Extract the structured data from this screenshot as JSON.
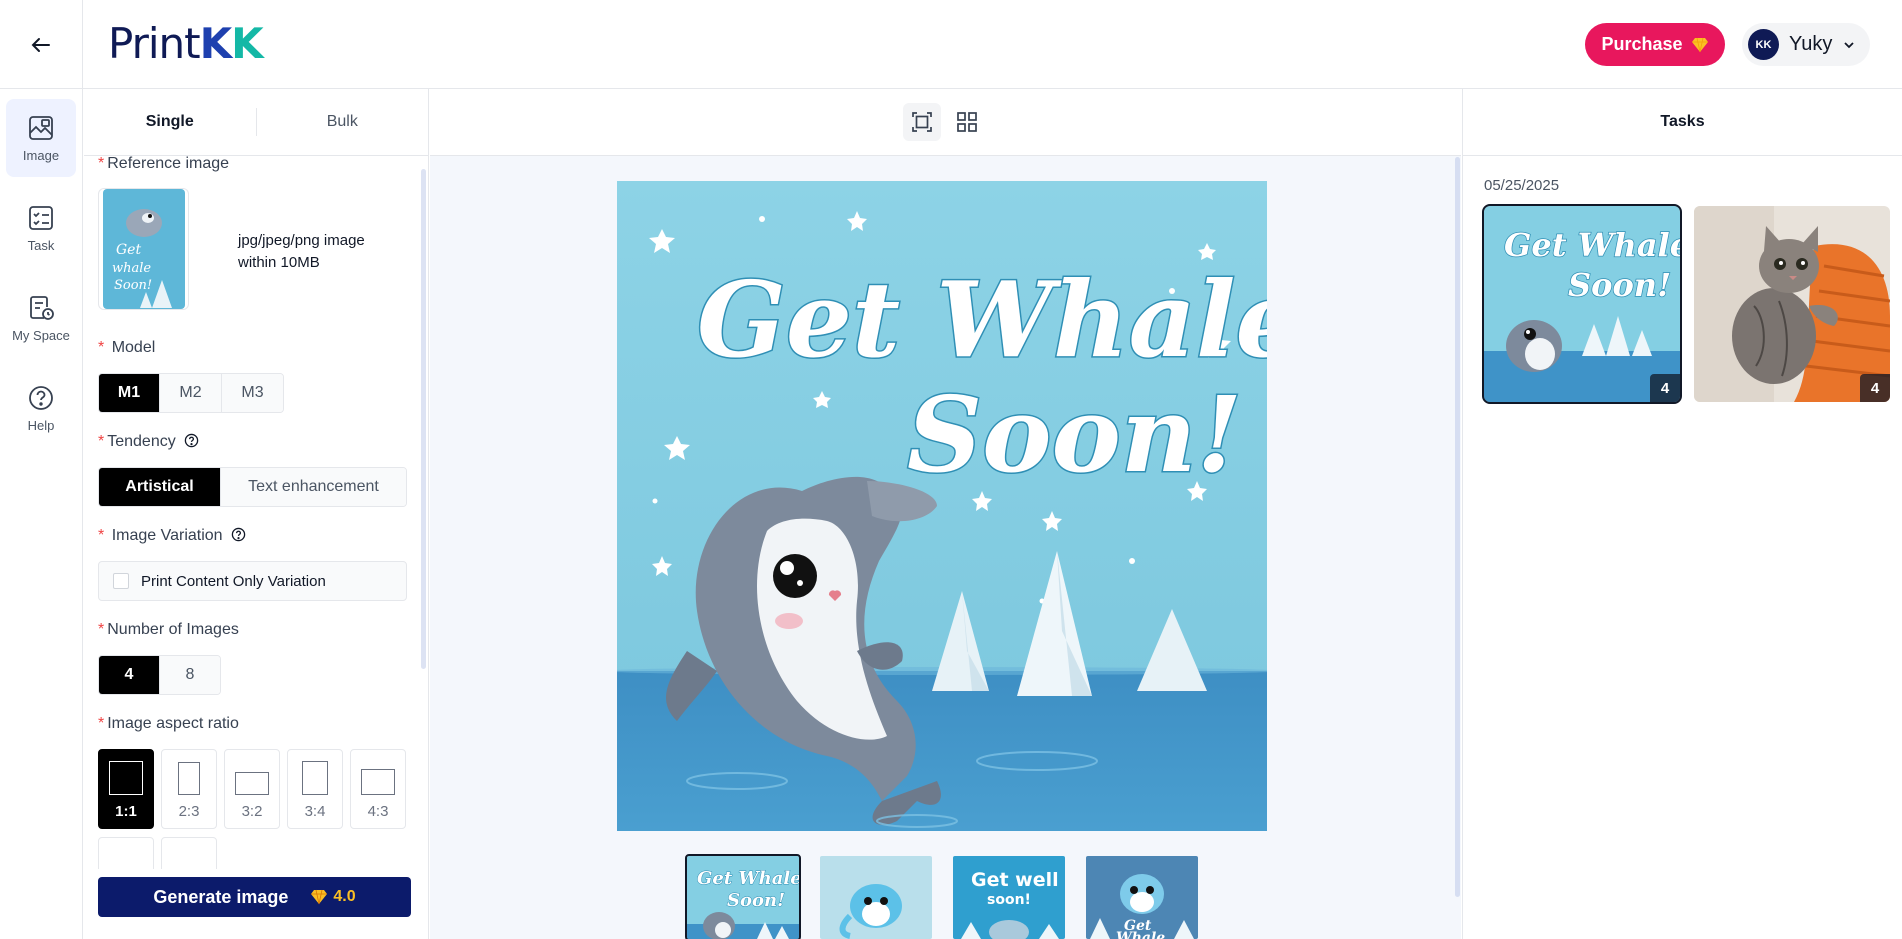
{
  "header": {
    "logo_text": "PrintKK",
    "logo_parts": [
      "Print",
      "K",
      "K"
    ],
    "purchase_label": "Purchase",
    "user_name": "Yuky",
    "avatar_initials": "KK"
  },
  "rail": {
    "items": [
      {
        "label": "Image",
        "icon": "image-icon",
        "active": true
      },
      {
        "label": "Task",
        "icon": "checklist-icon",
        "active": false
      },
      {
        "label": "My Space",
        "icon": "document-clock-icon",
        "active": false
      },
      {
        "label": "Help",
        "icon": "question-icon",
        "active": false
      }
    ]
  },
  "panel": {
    "tabs": [
      "Single",
      "Bulk"
    ],
    "active_tab": "Single",
    "reference_label": "Reference image",
    "reference_hint": "jpg/jpeg/png image within 10MB",
    "model_label": "Model",
    "models": [
      "M1",
      "M2",
      "M3"
    ],
    "selected_model": "M1",
    "tendency_label": "Tendency",
    "tendencies": [
      "Artistical",
      "Text enhancement"
    ],
    "selected_tendency": "Artistical",
    "variation_label": "Image Variation",
    "variation_option": "Print Content Only Variation",
    "variation_checked": false,
    "count_label": "Number of Images",
    "counts": [
      "4",
      "8"
    ],
    "selected_count": "4",
    "ratio_label": "Image aspect ratio",
    "ratios": [
      "1:1",
      "2:3",
      "3:2",
      "3:4",
      "4:3"
    ],
    "selected_ratio": "1:1",
    "generate_label": "Generate image",
    "generate_cost": "4.0"
  },
  "canvas": {
    "main_image_text": [
      "Get Whale",
      "Soon!"
    ],
    "variants": [
      {
        "text": "Get Whale Soon!",
        "active": true
      },
      {
        "text": "",
        "active": false
      },
      {
        "text": "Get well soon!",
        "active": false
      },
      {
        "text": "Get Whale",
        "active": false
      }
    ],
    "colors": {
      "sky": "#7dcde0",
      "sea": "#3f93c8",
      "accent": "#0c1b6b",
      "brand_pink": "#e8175d"
    }
  },
  "tasks": {
    "title": "Tasks",
    "date": "05/25/2025",
    "cards": [
      {
        "type": "whale",
        "count": "4",
        "active": true
      },
      {
        "type": "kitten",
        "count": "4",
        "active": false
      }
    ]
  }
}
